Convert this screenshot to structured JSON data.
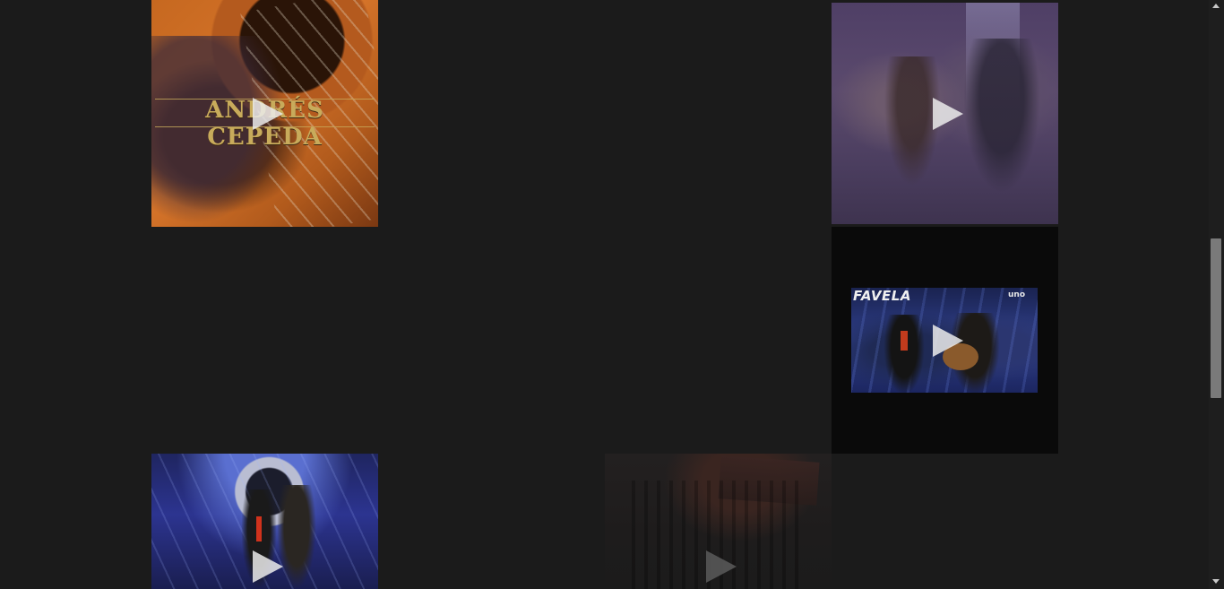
{
  "grid": {
    "tiles": [
      {
        "id": "t1",
        "kind": "video",
        "overlay_text": "ANDRÉS CEPEDA"
      },
      {
        "id": "t2",
        "kind": "video"
      },
      {
        "id": "t3",
        "kind": "video",
        "overlay_text": "FAVELA",
        "channel_logo": "uno"
      },
      {
        "id": "t4",
        "kind": "video"
      },
      {
        "id": "t5",
        "kind": "video"
      }
    ]
  },
  "icons": {
    "play": "play-icon",
    "scroll_up": "chevron-up-icon",
    "scroll_down": "chevron-down-icon"
  },
  "colors": {
    "page_background": "#1b1b1b",
    "scrollbar_track": "#1e1e1e",
    "scrollbar_thumb": "#7a7a7a"
  }
}
